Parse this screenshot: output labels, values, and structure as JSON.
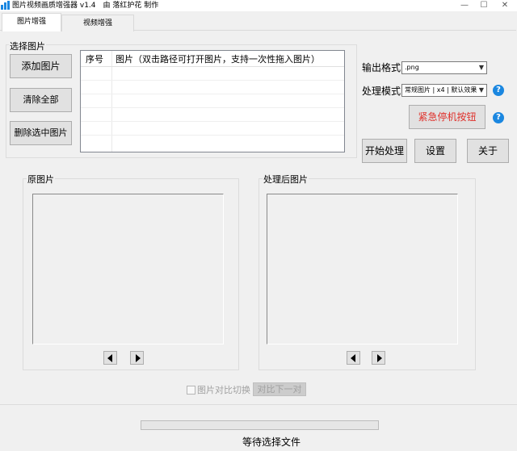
{
  "window": {
    "title": "图片视频画质增强器 v1.4　由 落红护花 制作",
    "minimize": "—",
    "maximize": "☐",
    "close": "✕"
  },
  "tabs": [
    {
      "label": "图片增强",
      "active": true
    },
    {
      "label": "视频增强",
      "active": false
    }
  ],
  "select_group": {
    "label": "选择图片",
    "add_button": "添加图片",
    "clear_button": "清除全部",
    "delete_button": "删除选中图片"
  },
  "file_list": {
    "col_index": "序号",
    "col_path": "图片（双击路径可打开图片，支持一次性拖入图片）"
  },
  "settings": {
    "output_format_label": "输出格式",
    "output_format_value": ".png",
    "mode_label": "处理模式",
    "mode_value": "常规图片 | x4 | 默认效果",
    "emergency_button": "紧急停机按钮",
    "help_glyph": "?"
  },
  "actions": {
    "start": "开始处理",
    "settings": "设置",
    "about": "关于"
  },
  "original_panel": {
    "label": "原图片"
  },
  "processed_panel": {
    "label": "处理后图片"
  },
  "compare": {
    "toggle_label": "图片对比切换",
    "next_button": "对比下一对"
  },
  "status": {
    "progress": 0,
    "text": "等待选择文件"
  },
  "colors": {
    "emergency_text": "#e0302a",
    "help_blue": "#1b87e0"
  }
}
